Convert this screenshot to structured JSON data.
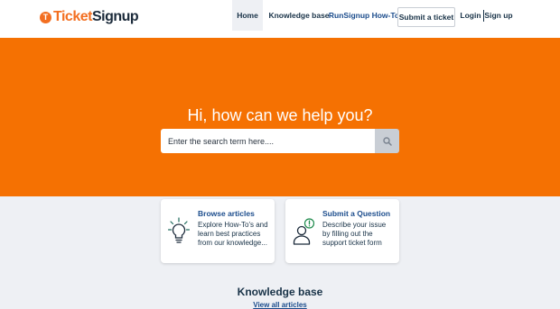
{
  "brand": {
    "logo_mark": "T",
    "name_part1": "Ticket",
    "name_part2": "Signup",
    "accent": "#f36f21"
  },
  "nav": {
    "home": "Home",
    "knowledge_base": "Knowledge base",
    "howto": "RunSignup How-To",
    "submit_ticket": "Submit a ticket",
    "login": "Login",
    "signup": "Sign up"
  },
  "hero": {
    "title": "Hi, how can we help you?",
    "background": "#f57102",
    "search": {
      "placeholder": "Enter the search term here....",
      "value": "",
      "icon": "search-icon"
    }
  },
  "cards": [
    {
      "title": "Browse articles",
      "description": "Explore How-To's and learn best practices from our knowledge...",
      "icon": "lightbulb-icon"
    },
    {
      "title": "Submit a Question",
      "description": "Describe your issue by filling out the support ticket form",
      "icon": "person-alert-icon"
    }
  ],
  "knowledge_base": {
    "title": "Knowledge base",
    "link": "View all articles"
  }
}
